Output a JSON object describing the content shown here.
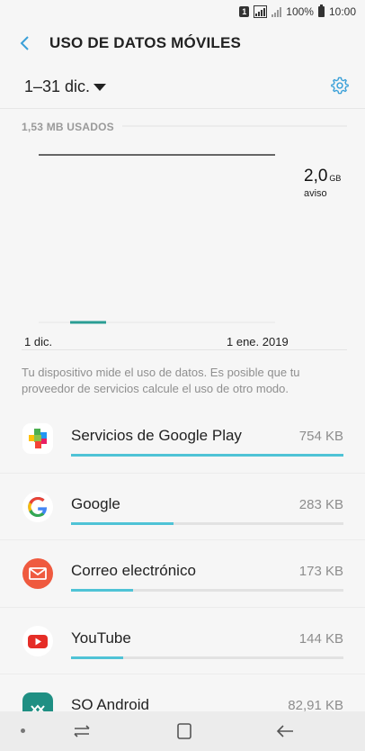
{
  "status_bar": {
    "sim": "1",
    "battery_text": "100%",
    "time": "10:00"
  },
  "header": {
    "title": "USO DE DATOS MÓVILES"
  },
  "period": {
    "label": "1–31 dic."
  },
  "usage": {
    "used_label": "1,53 MB USADOS",
    "warning_value": "2,0",
    "warning_unit": "GB",
    "warning_label": "aviso",
    "start_date": "1 dic.",
    "end_date": "1 ene. 2019"
  },
  "note": "Tu dispositivo mide el uso de datos. Es posible que tu proveedor de servicios calcule el uso de otro modo.",
  "apps": [
    {
      "name": "Servicios de Google Play",
      "size": "754 KB",
      "fraction": 1.0,
      "icon": "google-play-services-icon"
    },
    {
      "name": "Google",
      "size": "283 KB",
      "fraction": 0.375,
      "icon": "google-icon"
    },
    {
      "name": "Correo electrónico",
      "size": "173 KB",
      "fraction": 0.229,
      "icon": "email-icon"
    },
    {
      "name": "YouTube",
      "size": "144 KB",
      "fraction": 0.191,
      "icon": "youtube-icon"
    },
    {
      "name": "SO Android",
      "size": "82,91 KB",
      "fraction": 0.11,
      "icon": "android-os-icon"
    }
  ],
  "colors": {
    "accent": "#4fc3d6",
    "usage_line": "#2a9d94"
  }
}
